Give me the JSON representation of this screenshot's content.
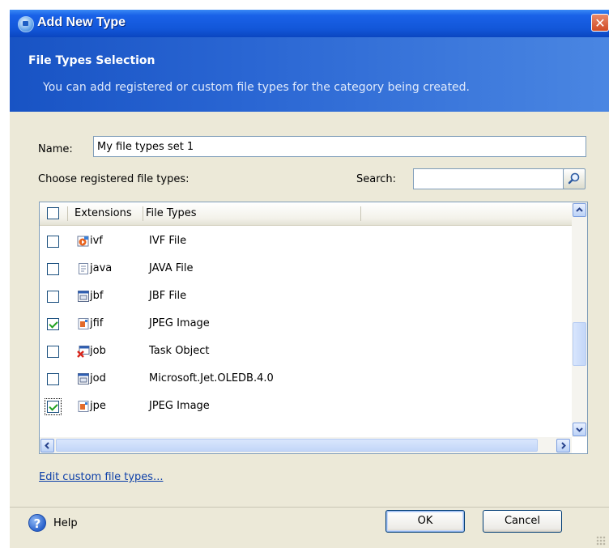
{
  "window": {
    "title": "Add New Type",
    "close_symbol": "✕"
  },
  "banner": {
    "title": "File Types Selection",
    "subtitle": "You can add registered or custom file types for the category being created."
  },
  "form": {
    "name_label": "Name:",
    "name_value": "My file types set 1",
    "choose_label": "Choose registered file types:",
    "search_label": "Search:",
    "search_value": ""
  },
  "list": {
    "columns": [
      "Extensions",
      "File Types"
    ],
    "rows": [
      {
        "ext": "ivf",
        "type": "IVF File",
        "checked": false,
        "icon": "media-file-icon"
      },
      {
        "ext": "java",
        "type": "JAVA File",
        "checked": false,
        "icon": "text-file-icon"
      },
      {
        "ext": "jbf",
        "type": "JBF File",
        "checked": false,
        "icon": "app-file-icon"
      },
      {
        "ext": "jfif",
        "type": "JPEG Image",
        "checked": true,
        "icon": "image-file-icon"
      },
      {
        "ext": "job",
        "type": "Task Object",
        "checked": false,
        "icon": "task-file-icon"
      },
      {
        "ext": "jod",
        "type": "Microsoft.Jet.OLEDB.4.0",
        "checked": false,
        "icon": "app-file-icon"
      },
      {
        "ext": "jpe",
        "type": "JPEG Image",
        "checked": true,
        "icon": "image-file-icon"
      }
    ]
  },
  "links": {
    "edit_custom": "Edit custom file types..."
  },
  "footer": {
    "help_label": "Help",
    "help_symbol": "?",
    "ok_label": "OK",
    "cancel_label": "Cancel"
  },
  "colors": {
    "titlebar": "#1256d8",
    "banner": "#2a66d3",
    "link": "#0b3ea8",
    "check": "#21a121"
  }
}
